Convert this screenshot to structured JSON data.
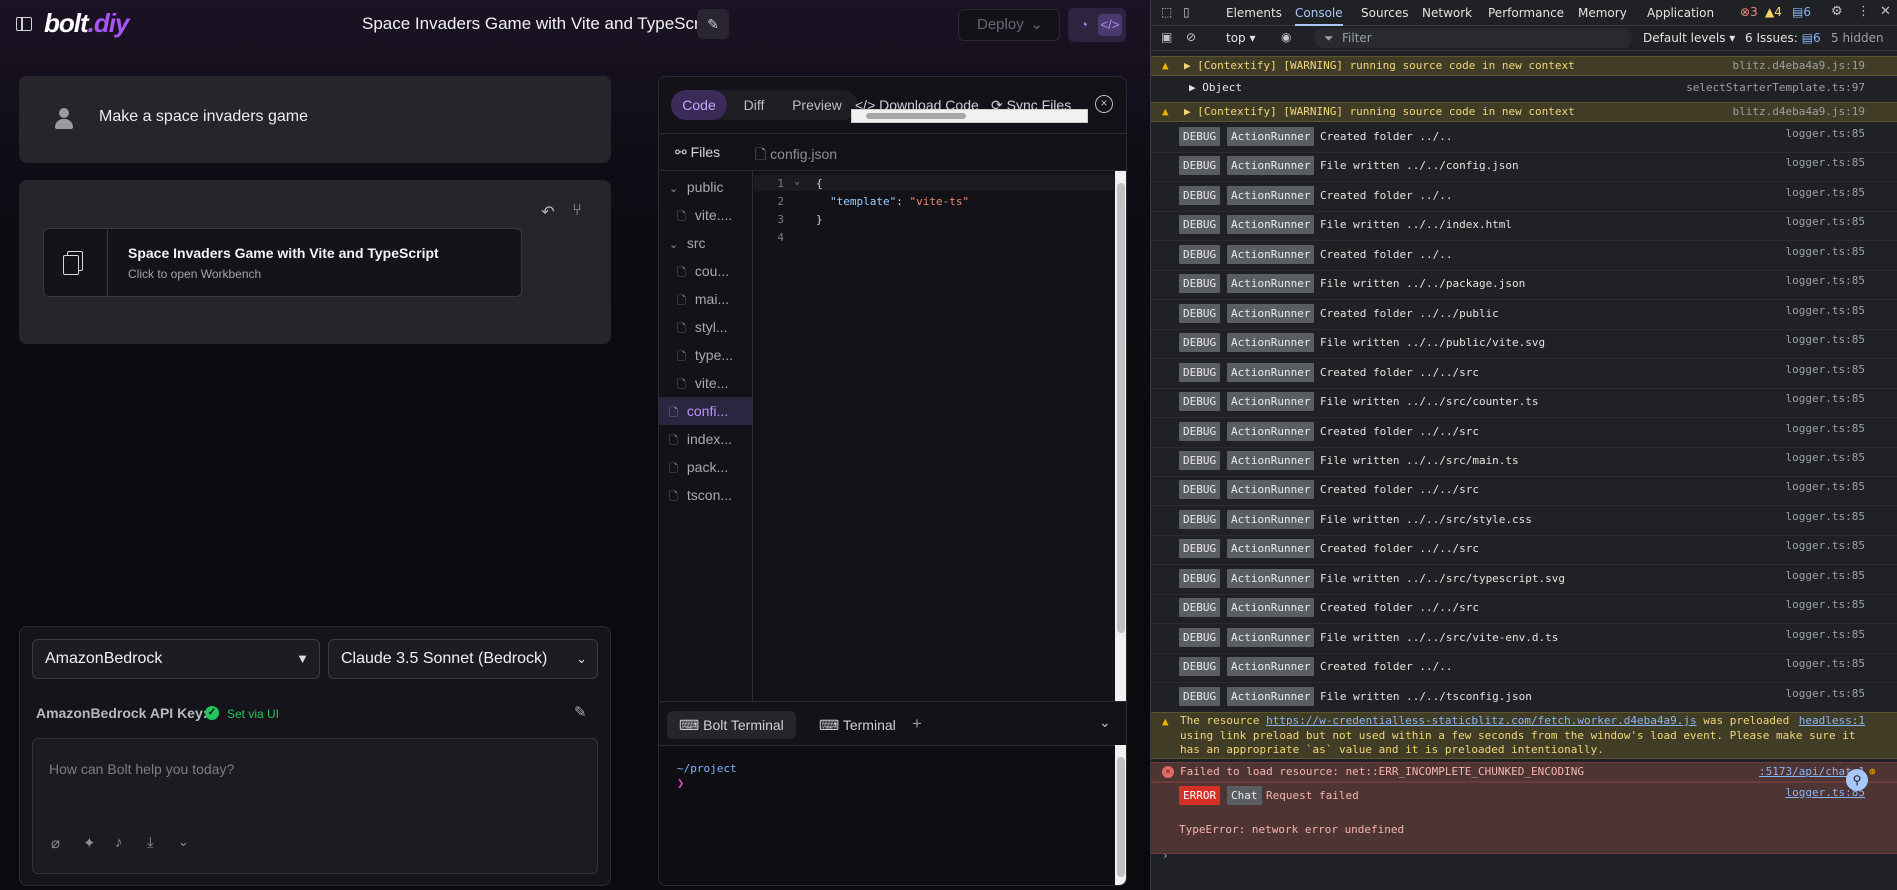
{
  "app": {
    "logo_main": "bolt",
    "logo_suffix": ".diy",
    "project_title": "Space Invaders Game with Vite and TypeScript",
    "deploy_label": "Deploy"
  },
  "chat": {
    "user_message": "Make a space invaders game",
    "artifact_title": "Space Invaders Game with Vite and TypeScript",
    "artifact_subtitle": "Click to open Workbench"
  },
  "input": {
    "provider": "AmazonBedrock",
    "model": "Claude 3.5 Sonnet (Bedrock)",
    "api_key_label": "AmazonBedrock API Key:",
    "api_key_status": "Set via UI",
    "placeholder": "How can Bolt help you today?"
  },
  "workbench": {
    "tabs": [
      "Code",
      "Diff",
      "Preview"
    ],
    "download_label": "Download Code",
    "sync_label": "Sync Files",
    "files_label": "Files",
    "open_file": "config.json",
    "tree": [
      {
        "label": "public",
        "type": "folder"
      },
      {
        "label": "vite....",
        "type": "file"
      },
      {
        "label": "src",
        "type": "folder"
      },
      {
        "label": "cou...",
        "type": "file"
      },
      {
        "label": "mai...",
        "type": "file"
      },
      {
        "label": "styl...",
        "type": "file"
      },
      {
        "label": "type...",
        "type": "file"
      },
      {
        "label": "vite...",
        "type": "file"
      },
      {
        "label": "confi...",
        "type": "file",
        "active": true
      },
      {
        "label": "index...",
        "type": "file"
      },
      {
        "label": "pack...",
        "type": "file"
      },
      {
        "label": "tscon...",
        "type": "file"
      }
    ],
    "code_lines": [
      "{",
      "\"template\": \"vite-ts\"",
      "}",
      ""
    ],
    "code_key": "\"template\"",
    "code_value": "\"vite-ts\"",
    "terminal_tabs": [
      "Bolt Terminal",
      "Terminal"
    ],
    "terminal_path": "~/project",
    "terminal_prompt": "❯"
  },
  "devtools": {
    "tabs": [
      "Elements",
      "Console",
      "Sources",
      "Network",
      "Performance",
      "Memory",
      "Application"
    ],
    "error_count": "3",
    "warning_count": "4",
    "info_count": "6",
    "context": "top",
    "filter_placeholder": "Filter",
    "levels": "Default levels",
    "issues_label": "6 Issues:",
    "issues_count": "6",
    "hidden_label": "5 hidden",
    "warn1": "▶ [Contextify] [WARNING] running source code in new context",
    "warn1_src": "blitz.d4eba4a9.js:19",
    "object_row": "▶ Object",
    "object_src": "selectStarterTemplate.ts:97",
    "warn2": "▶ [Contextify] [WARNING] running source code in new context",
    "warn2_src": "blitz.d4eba4a9.js:19",
    "debug_tag": "DEBUG",
    "runner_tag": "ActionRunner",
    "logger_src": "logger.ts:85",
    "logs": [
      "Created folder ../..",
      "File written ../../config.json",
      "Created folder ../..",
      "File written ../../index.html",
      "Created folder ../..",
      "File written ../../package.json",
      "Created folder ../../public",
      "File written ../../public/vite.svg",
      "Created folder ../../src",
      "File written ../../src/counter.ts",
      "Created folder ../../src",
      "File written ../../src/main.ts",
      "Created folder ../../src",
      "File written ../../src/style.css",
      "Created folder ../../src",
      "File written ../../src/typescript.svg",
      "Created folder ../../src",
      "File written ../../src/vite-env.d.ts",
      "Created folder ../..",
      "File written ../../tsconfig.json"
    ],
    "preload_prefix": "The resource",
    "preload_url": "https://w-credentialless-staticblitz.com/fetch.worker.d4eba4a9.js",
    "preload_mid": "was preloaded",
    "preload_src": "headless:1",
    "preload_line2": "using link preload but not used within a few seconds from the window's load event. Please make sure it",
    "preload_line3": "has an appropriate `as` value and it is preloaded intentionally.",
    "fail_text": "Failed to load resource: net::ERR_INCOMPLETE_CHUNKED_ENCODING",
    "fail_src": ":5173/api/chat:1",
    "error_tag": "ERROR",
    "chat_tag": "Chat",
    "request_failed": "Request failed",
    "request_src": "logger.ts:85",
    "type_error": "TypeError: network error undefined",
    "prompt": "›"
  }
}
